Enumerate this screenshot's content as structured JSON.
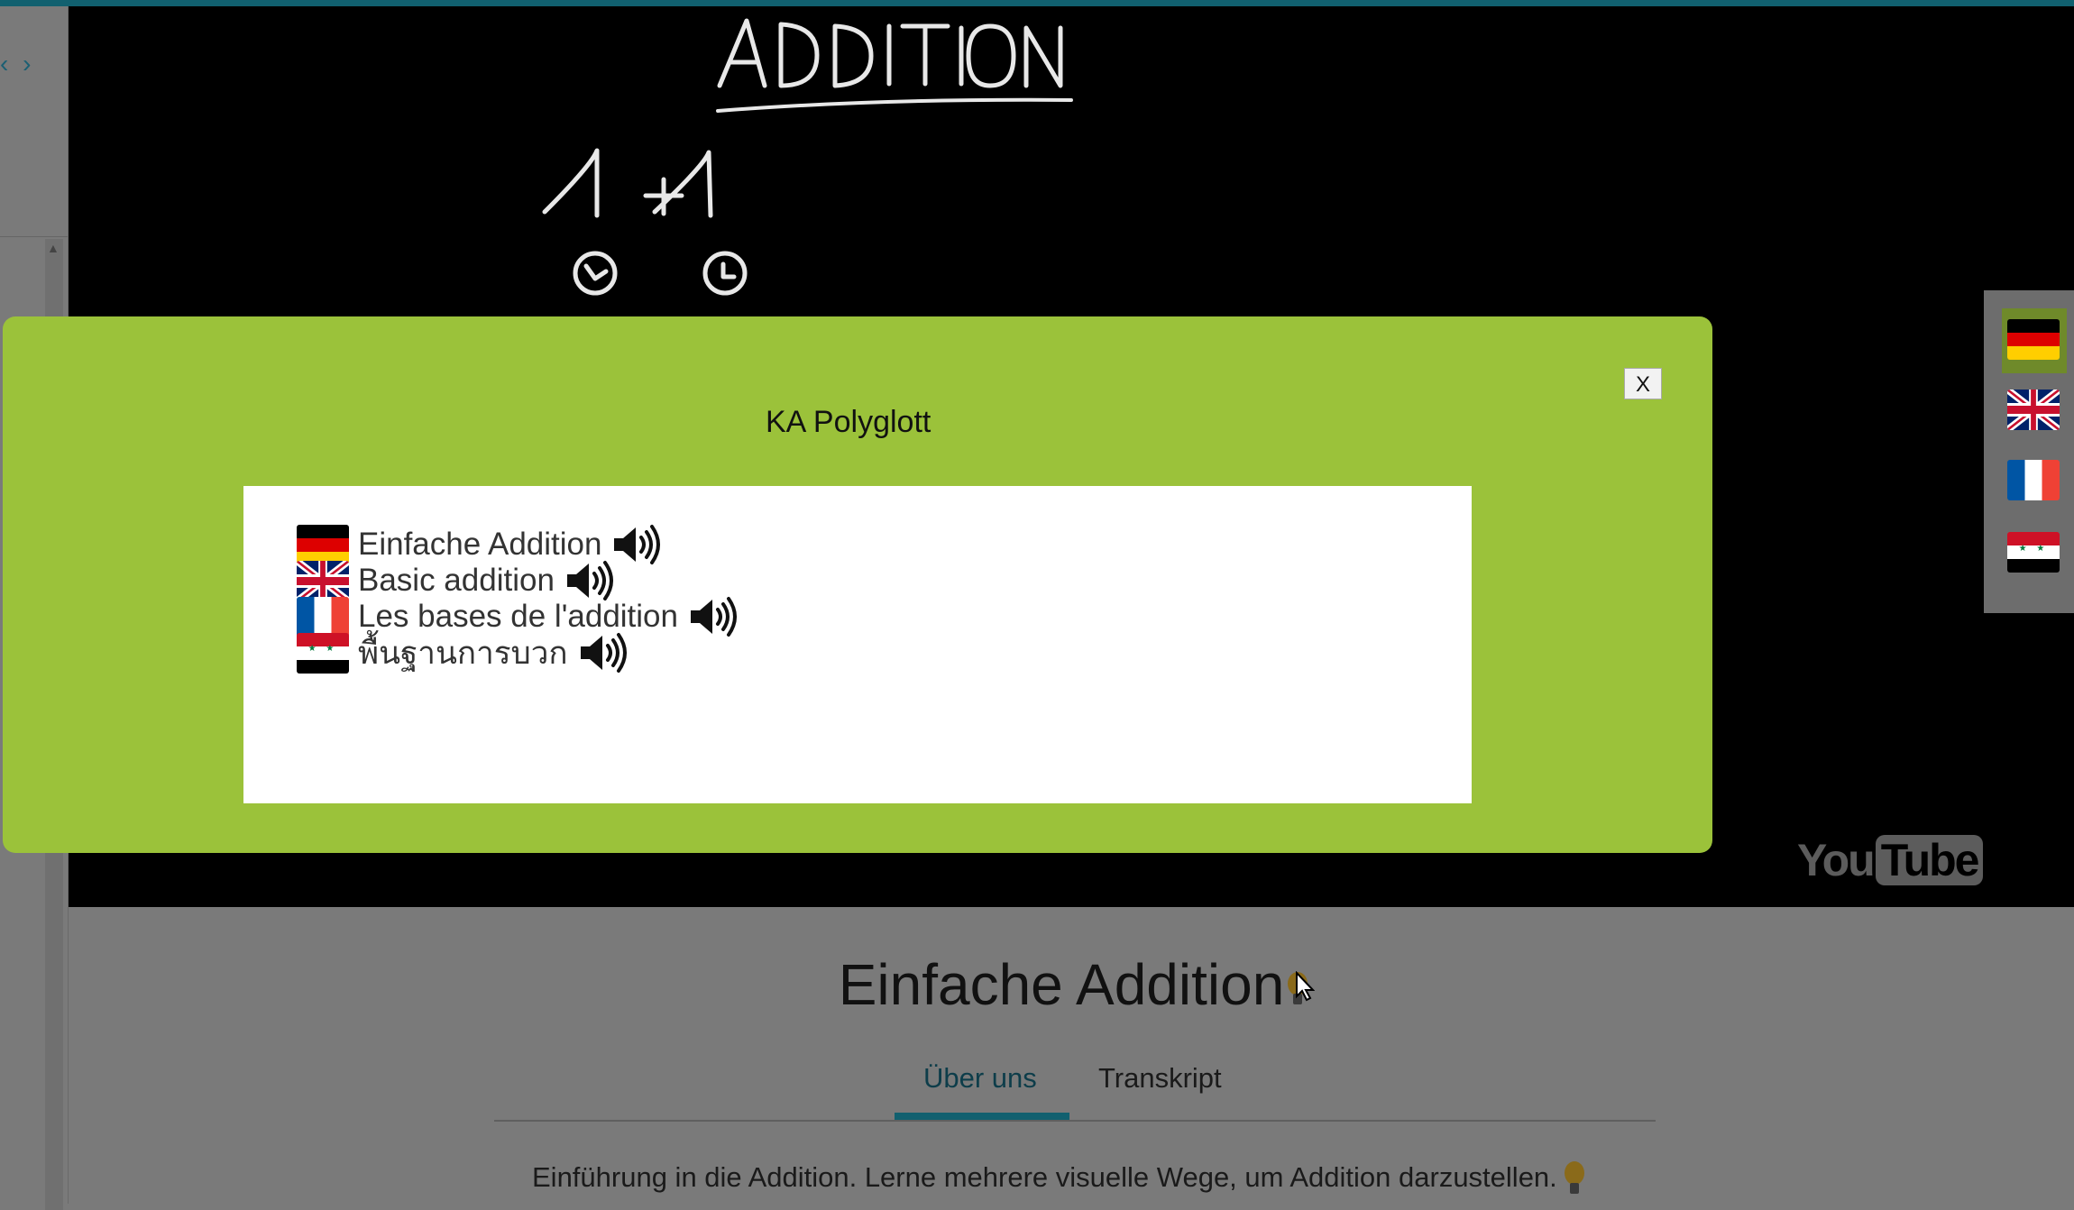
{
  "nav": {
    "arrows": "‹ ›"
  },
  "video": {
    "brand_you": "You",
    "brand_tube": "Tube"
  },
  "side_flags": [
    {
      "icon": "germany-flag-icon",
      "selected": true
    },
    {
      "icon": "uk-flag-icon",
      "selected": false
    },
    {
      "icon": "france-flag-icon",
      "selected": false
    },
    {
      "icon": "syria-flag-icon",
      "selected": false
    }
  ],
  "page": {
    "title": "Einfache Addition",
    "tabs": [
      "Über uns",
      "Transkript"
    ],
    "active_tab": "Über uns",
    "description": "Einführung in die Addition. Lerne mehrere visuelle Wege, um Addition darzustellen."
  },
  "modal": {
    "title": "KA Polyglott",
    "close_label": "X",
    "translations": [
      {
        "flag": "germany-flag-icon",
        "text": "Einfache Addition"
      },
      {
        "flag": "uk-flag-icon",
        "text": "Basic addition"
      },
      {
        "flag": "france-flag-icon",
        "text": "Les bases de l'addition"
      },
      {
        "flag": "syria-flag-icon",
        "text": "พื้นฐานการบวก"
      }
    ]
  },
  "colors": {
    "accent": "#11606f",
    "modal_bg": "#9bc23a",
    "overlay_gray": "#7a7a7a"
  }
}
